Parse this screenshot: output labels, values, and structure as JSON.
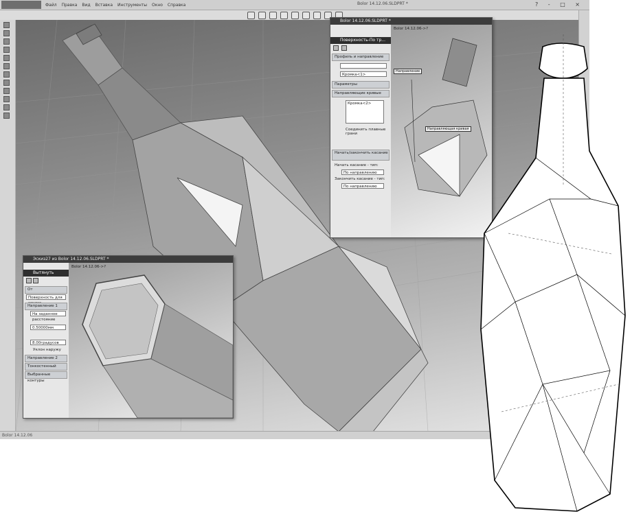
{
  "app": {
    "menu": [
      "Файл",
      "Правка",
      "Вид",
      "Вставка",
      "Инструменты",
      "Окно",
      "Справка"
    ],
    "doc_title": "Bolor 14.12.06.SLDPRT *",
    "status_text": "Bolor 14.12.06",
    "window_controls": [
      "?",
      "-",
      "□",
      "×"
    ]
  },
  "surface_window": {
    "doc_title": "Bolor 14.12.06.SLDPRT *",
    "tree_label": "Bolor 14.12.06->?",
    "pm_title": "Поверхность-По тр...",
    "sections": {
      "profiles": "Профиль и направление",
      "params": "Параметры",
      "guides": "Направляющие кривые",
      "start_end": "Начать/закончить касание"
    },
    "profile_value": "Кромка<1>",
    "guide_value": "Кромка<2>",
    "merge_label": "Соединить плавные грани",
    "start_label": "Начать касание - тип:",
    "start_value": "По направлению",
    "end_label": "Закончить касание - тип:",
    "end_value": "По направлению",
    "callout_direction": "Направление",
    "callout_guide": "Направляющая кривая"
  },
  "extrude_window": {
    "doc_title": "Эскиз27 из Bolor 14.12.06.SLDPRT *",
    "tree_label": "Bolor 14.12.06->?",
    "pm_title": "Вытянуть",
    "from_label": "От",
    "from_value": "Поверхность для эскиза",
    "direction1": "Направление 1",
    "dir_value": "На заданное расстояние",
    "depth_value": "0.50000мм",
    "draft_value": "8.00градусов",
    "draft_outward": "Уклон наружу",
    "sections_extra": [
      "Направление 2",
      "Тонкостенный элемент",
      "Выбранные контуры"
    ]
  },
  "colors": {
    "viewport_dark": "#6a6a6a",
    "viewport_light": "#e6e6e6",
    "panel": "#e7e7e7",
    "titlebar": "#2e2e2e"
  }
}
